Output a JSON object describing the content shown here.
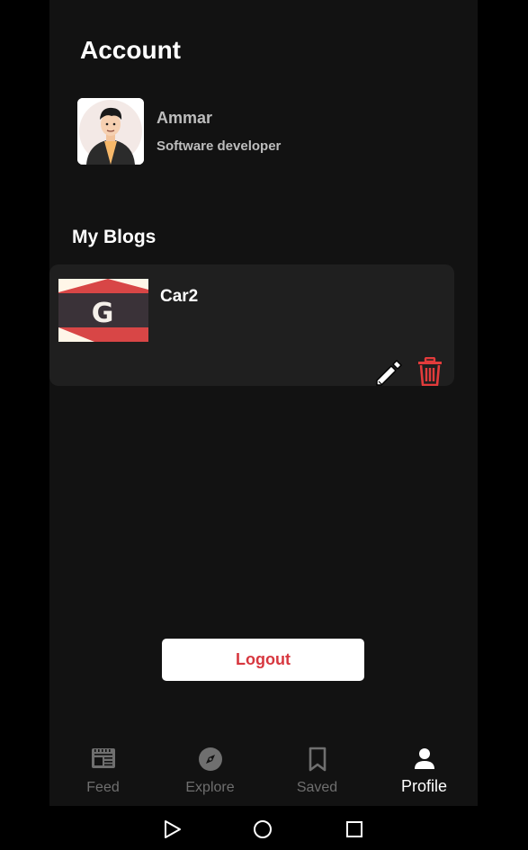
{
  "account": {
    "title": "Account",
    "user_name": "Ammar",
    "user_role": "Software developer"
  },
  "blogs": {
    "section_title": "My Blogs",
    "items": [
      {
        "title": "Car2"
      }
    ]
  },
  "logout_label": "Logout",
  "tabs": [
    {
      "label": "Feed",
      "icon": "feed-icon",
      "active": false
    },
    {
      "label": "Explore",
      "icon": "compass-icon",
      "active": false
    },
    {
      "label": "Saved",
      "icon": "bookmark-icon",
      "active": false
    },
    {
      "label": "Profile",
      "icon": "person-icon",
      "active": true
    }
  ],
  "colors": {
    "background": "#121212",
    "card": "#1f1f1f",
    "accent_red": "#d7373f",
    "text": "#ffffff",
    "muted_text": "#bdbdbd",
    "inactive_tab": "#6f6f6f"
  }
}
